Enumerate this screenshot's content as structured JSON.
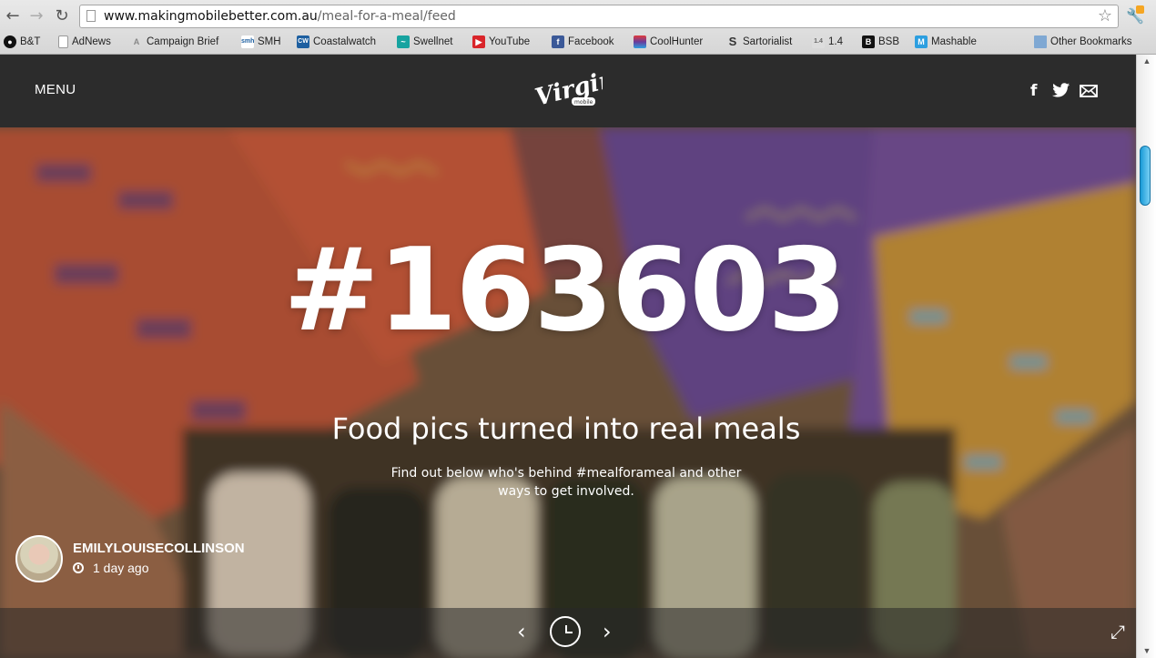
{
  "browser": {
    "url_domain": "www.makingmobilebetter.com.au",
    "url_path": "/meal-for-a-meal/feed",
    "back_icon": "back-arrow-icon",
    "forward_icon": "forward-arrow-icon",
    "reload_icon": "reload-icon",
    "bookmarks": [
      {
        "label": "B&T",
        "icon": "bt-icon",
        "color": "#111111"
      },
      {
        "label": "AdNews",
        "icon": "page-icon",
        "color": "#ffffff"
      },
      {
        "label": "Campaign Brief",
        "icon": "campaign-brief-icon",
        "color": "#888888"
      },
      {
        "label": "SMH",
        "icon": "smh-icon",
        "color": "#ffffff"
      },
      {
        "label": "Coastalwatch",
        "icon": "coastalwatch-icon",
        "color": "#1d5fa0"
      },
      {
        "label": "Swellnet",
        "icon": "swellnet-icon",
        "color": "#17a3a0"
      },
      {
        "label": "YouTube",
        "icon": "youtube-icon",
        "color": "#d9252a"
      },
      {
        "label": "Facebook",
        "icon": "facebook-icon",
        "color": "#3b5998"
      },
      {
        "label": "CoolHunter",
        "icon": "coolhunter-icon",
        "color": "#6a3c9b"
      },
      {
        "label": "Sartorialist",
        "icon": "sartorialist-icon",
        "color": "#ffffff"
      },
      {
        "label": "1.4",
        "icon": "1-4-icon",
        "color": "#cccccc"
      },
      {
        "label": "BSB",
        "icon": "bsb-icon",
        "color": "#111111"
      },
      {
        "label": "Mashable",
        "icon": "mashable-icon",
        "color": "#2d9fe0"
      }
    ],
    "other_bookmarks": "Other Bookmarks"
  },
  "header": {
    "menu_label": "MENU",
    "logo_text": "Virgin",
    "logo_subtext": "mobile"
  },
  "hero": {
    "hashtag_number": "#163603",
    "tagline": "Food pics turned into real meals",
    "subtext": "Find out below who's behind #mealforameal and other ways to get involved.",
    "username": "EMILYLOUISECOLLINSON",
    "time_ago": "1 day ago"
  }
}
